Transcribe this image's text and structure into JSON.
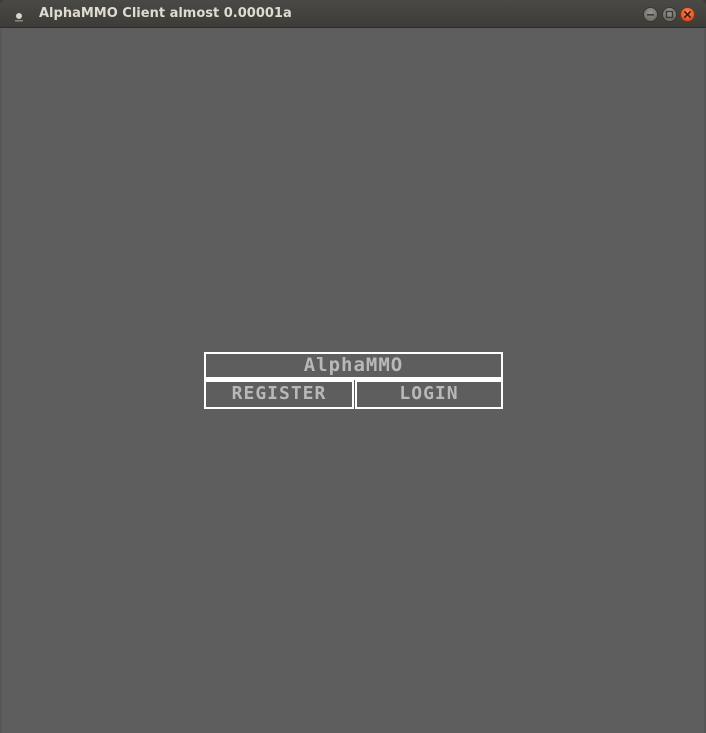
{
  "window": {
    "title": "AlphaMMO Client almost 0.00001a",
    "controls": {
      "minimize_icon": "minimize-icon",
      "maximize_icon": "maximize-icon",
      "close_icon": "close-icon"
    }
  },
  "game": {
    "title": "AlphaMMO",
    "buttons": {
      "register": "REGISTER",
      "login": "LOGIN"
    }
  },
  "colors": {
    "background": "#5e5e5e",
    "titlebar": "#3d3c38",
    "frame": "#ffffff",
    "text": "#b8b8b8",
    "close_button": "#e9542a"
  }
}
